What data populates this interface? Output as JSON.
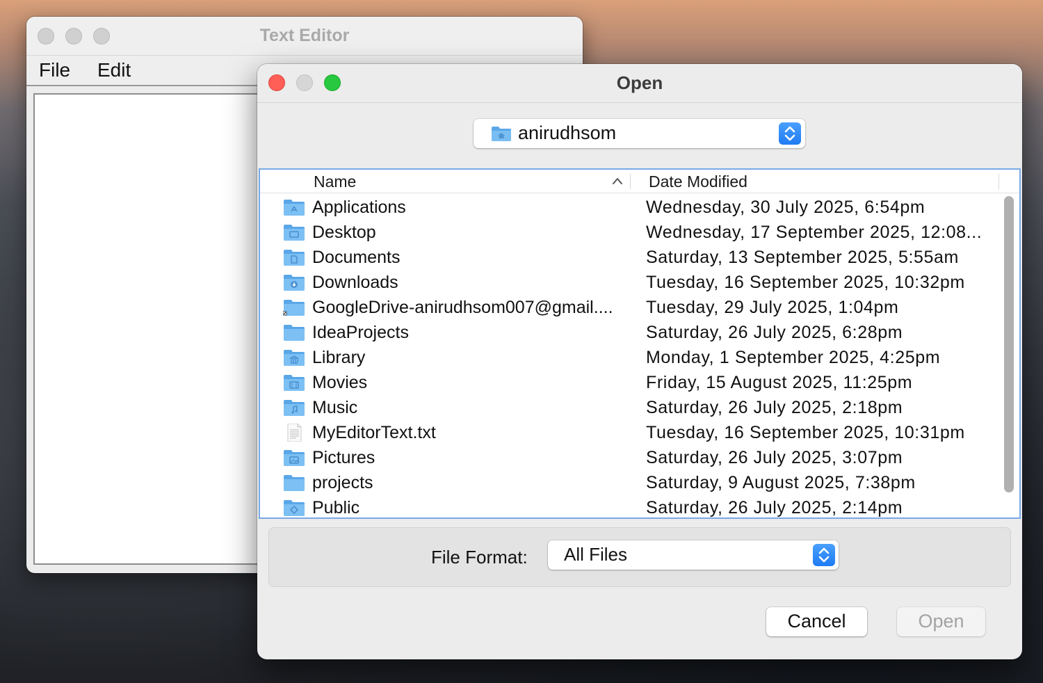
{
  "editor_window": {
    "title": "Text Editor",
    "menu": [
      "File",
      "Edit"
    ]
  },
  "open_dialog": {
    "title": "Open",
    "location": {
      "label": "anirudhsom",
      "icon": "home-folder-icon"
    },
    "columns": {
      "name": "Name",
      "date": "Date Modified",
      "sort": "ascending"
    },
    "files": [
      {
        "name": "Applications",
        "date": "Wednesday, 30 July 2025, 6:54pm",
        "icon": "applications-folder-icon"
      },
      {
        "name": "Desktop",
        "date": "Wednesday, 17 September 2025, 12:08...",
        "icon": "desktop-folder-icon"
      },
      {
        "name": "Documents",
        "date": "Saturday, 13 September 2025, 5:55am",
        "icon": "documents-folder-icon"
      },
      {
        "name": "Downloads",
        "date": "Tuesday, 16 September 2025, 10:32pm",
        "icon": "downloads-folder-icon"
      },
      {
        "name": "GoogleDrive-anirudhsom007@gmail....",
        "date": "Tuesday, 29 July 2025, 1:04pm",
        "icon": "alias-folder-icon"
      },
      {
        "name": "IdeaProjects",
        "date": "Saturday, 26 July 2025, 6:28pm",
        "icon": "folder-icon"
      },
      {
        "name": "Library",
        "date": "Monday, 1 September 2025, 4:25pm",
        "icon": "library-folder-icon"
      },
      {
        "name": "Movies",
        "date": "Friday, 15 August 2025, 11:25pm",
        "icon": "movies-folder-icon"
      },
      {
        "name": "Music",
        "date": "Saturday, 26 July 2025, 2:18pm",
        "icon": "music-folder-icon"
      },
      {
        "name": "MyEditorText.txt",
        "date": "Tuesday, 16 September 2025, 10:31pm",
        "icon": "text-file-icon"
      },
      {
        "name": "Pictures",
        "date": "Saturday, 26 July 2025, 3:07pm",
        "icon": "pictures-folder-icon"
      },
      {
        "name": "projects",
        "date": "Saturday, 9 August 2025, 7:38pm",
        "icon": "folder-icon"
      },
      {
        "name": "Public",
        "date": "Saturday, 26 July 2025, 2:14pm",
        "icon": "public-folder-icon"
      }
    ],
    "file_format": {
      "label": "File Format:",
      "value": "All Files"
    },
    "buttons": {
      "cancel": "Cancel",
      "open": "Open"
    }
  },
  "colors": {
    "folder_blue": "#6fb4ec",
    "accent_blue": "#1f7bf2",
    "close_red": "#ff5f57",
    "zoom_green": "#28c840",
    "list_border": "#79a9e5"
  }
}
